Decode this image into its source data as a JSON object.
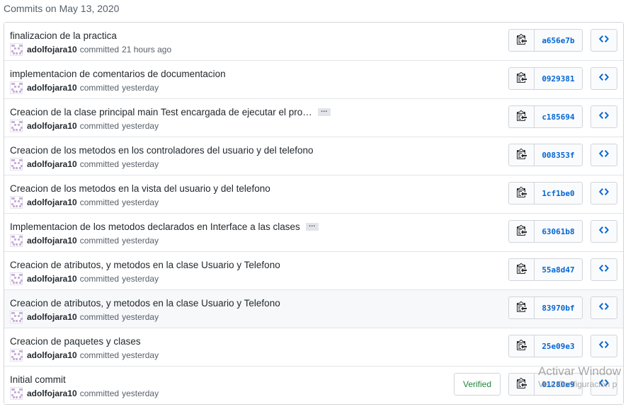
{
  "group_title": "Commits on May 13, 2020",
  "colors": {
    "link": "#0366d6",
    "verified": "#22863a",
    "border": "#d1d5da",
    "muted": "#586069"
  },
  "icons": {
    "copy": "clippy-icon",
    "browse": "code-icon"
  },
  "commits": [
    {
      "title": "finalizacion de la practica",
      "author": "adolfojara10",
      "action": "committed",
      "time": "21 hours ago",
      "sha": "a656e7b",
      "truncated": false
    },
    {
      "title": "implementacion de comentarios de documentacion",
      "author": "adolfojara10",
      "action": "committed",
      "time": "yesterday",
      "sha": "0929381",
      "truncated": false
    },
    {
      "title": "Creacion de la clase principal main Test encargada de ejecutar el pro…",
      "author": "adolfojara10",
      "action": "committed",
      "time": "yesterday",
      "sha": "c185694",
      "truncated": true
    },
    {
      "title": "Creacion de los metodos en los controladores del usuario y del telefono",
      "author": "adolfojara10",
      "action": "committed",
      "time": "yesterday",
      "sha": "008353f",
      "truncated": false
    },
    {
      "title": "Creacion de los metodos en la vista del usuario y del telefono",
      "author": "adolfojara10",
      "action": "committed",
      "time": "yesterday",
      "sha": "1cf1be0",
      "truncated": false
    },
    {
      "title": "Implementacion de los metodos declarados en Interface a las clases",
      "author": "adolfojara10",
      "action": "committed",
      "time": "yesterday",
      "sha": "63061b8",
      "truncated": true
    },
    {
      "title": "Creacion de atributos, y metodos en la clase Usuario y Telefono",
      "author": "adolfojara10",
      "action": "committed",
      "time": "yesterday",
      "sha": "55a8d47",
      "truncated": false
    },
    {
      "title": "Creacion de atributos, y metodos en la clase Usuario y Telefono",
      "author": "adolfojara10",
      "action": "committed",
      "time": "yesterday",
      "sha": "83970bf",
      "truncated": false,
      "hover": true
    },
    {
      "title": "Creacion de paquetes y clases",
      "author": "adolfojara10",
      "action": "committed",
      "time": "yesterday",
      "sha": "25e09e3",
      "truncated": false
    },
    {
      "title": "Initial commit",
      "author": "adolfojara10",
      "action": "committed",
      "time": "yesterday",
      "sha": "01280e9",
      "truncated": false,
      "verified": "Verified"
    }
  ],
  "ellipsis_label": "…",
  "watermark": {
    "line1": "Activar Window",
    "line2": "Ve a Configuración p"
  }
}
